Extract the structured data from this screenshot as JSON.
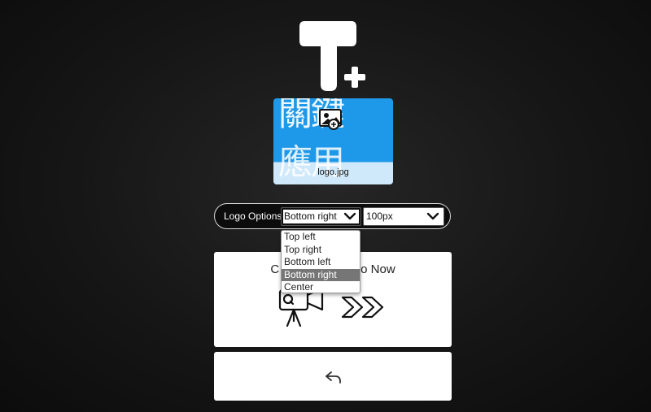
{
  "thumbnail": {
    "cjk_line1": "關鍵",
    "cjk_line2": "應用",
    "filename": "logo.jpg",
    "colors": {
      "blue": "#1e98e8",
      "light": "#cfe9fb"
    }
  },
  "logo_options": {
    "label": "Logo Options",
    "position_selected": "Bottom right",
    "size_selected": "100px",
    "position_options": [
      "Top left",
      "Top right",
      "Bottom left",
      "Bottom right",
      "Center"
    ],
    "highlighted_index": 3
  },
  "create_card": {
    "title_left": "C",
    "title_right": "o Now"
  },
  "icons": {
    "app_logo": "t-plus-logo",
    "thumbnail_overlay": "image-icon",
    "create": "video-camera-icon",
    "forward": "double-chevron-right-icon",
    "back": "back-arrow-icon"
  },
  "colors": {
    "background": "#161616",
    "card": "#ffffff",
    "selected_option": "#767676"
  }
}
